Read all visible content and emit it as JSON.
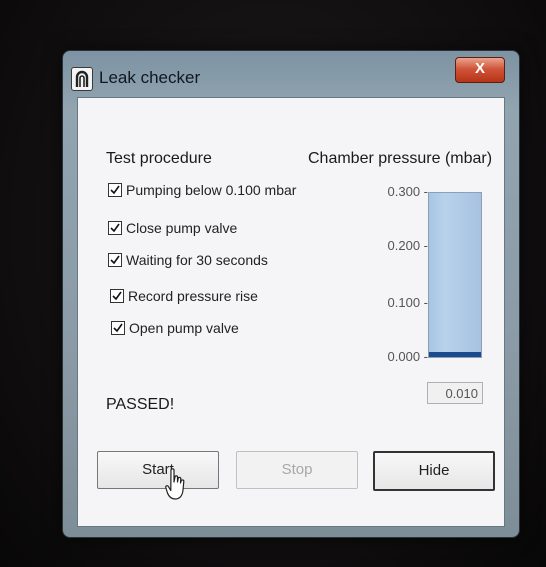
{
  "window": {
    "title": "Leak checker",
    "close_glyph": "X",
    "app_icon": "vacuum-logo-icon",
    "accent": "#1c4a8c"
  },
  "procedure": {
    "heading": "Test procedure",
    "steps": [
      {
        "label": "Pumping below 0.100 mbar",
        "checked": true
      },
      {
        "label": "Close pump valve",
        "checked": true
      },
      {
        "label": "Waiting for 30 seconds",
        "checked": true
      },
      {
        "label": "Record pressure rise",
        "checked": true
      },
      {
        "label": "Open pump valve",
        "checked": true
      }
    ]
  },
  "gauge": {
    "heading": "Chamber pressure (mbar)",
    "ticks": [
      "0.300 -",
      "0.200 -",
      "0.100 -",
      "0.000 -"
    ],
    "range": [
      0.0,
      0.3
    ],
    "value": 0.01,
    "readout": "0.010"
  },
  "status": {
    "result": "PASSED!"
  },
  "buttons": {
    "start": "Start",
    "stop": "Stop",
    "hide": "Hide"
  }
}
